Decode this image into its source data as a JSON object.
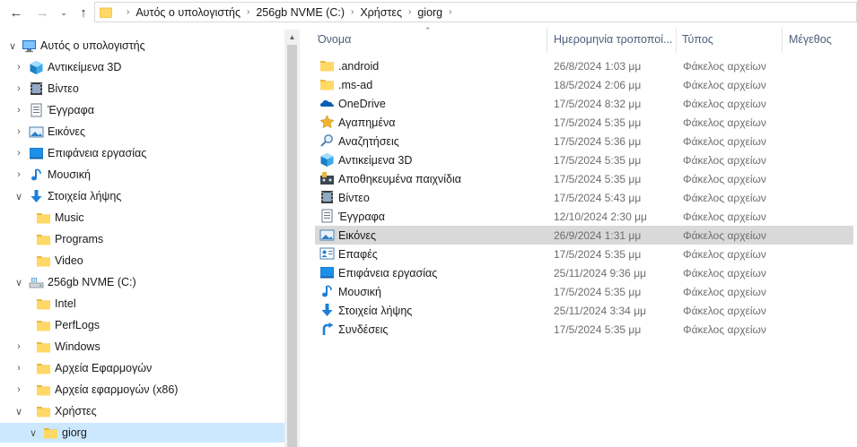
{
  "address_bar": {
    "crumbs": [
      "Αυτός ο υπολογιστής",
      "256gb NVME (C:)",
      "Χρήστες",
      "giorg"
    ]
  },
  "nav_tree": [
    {
      "label": "Αυτός ο υπολογιστής",
      "icon": "computer-icon",
      "level": 0,
      "expanded": true
    },
    {
      "label": "Αντικείμενα 3D",
      "icon": "3d-objects-icon",
      "level": 1,
      "expanded": false
    },
    {
      "label": "Βίντεο",
      "icon": "video-icon",
      "level": 1,
      "expanded": false
    },
    {
      "label": "Έγγραφα",
      "icon": "documents-icon",
      "level": 1,
      "expanded": false
    },
    {
      "label": "Εικόνες",
      "icon": "pictures-icon",
      "level": 1,
      "expanded": false
    },
    {
      "label": "Επιφάνεια εργασίας",
      "icon": "desktop-icon",
      "level": 1,
      "expanded": false
    },
    {
      "label": "Μουσική",
      "icon": "music-icon",
      "level": 1,
      "expanded": false
    },
    {
      "label": "Στοιχεία λήψης",
      "icon": "downloads-icon",
      "level": 1,
      "expanded": true
    },
    {
      "label": "Music",
      "icon": "folder-icon",
      "level": 2,
      "expanded": null
    },
    {
      "label": "Programs",
      "icon": "folder-icon",
      "level": 2,
      "expanded": null
    },
    {
      "label": "Video",
      "icon": "folder-icon",
      "level": 2,
      "expanded": null
    },
    {
      "label": "256gb NVME (C:)",
      "icon": "drive-icon",
      "level": 1,
      "expanded": true
    },
    {
      "label": "Intel",
      "icon": "folder-icon",
      "level": 2,
      "expanded": null
    },
    {
      "label": "PerfLogs",
      "icon": "folder-icon",
      "level": 2,
      "expanded": null
    },
    {
      "label": "Windows",
      "icon": "folder-icon",
      "level": 2,
      "expanded": false
    },
    {
      "label": "Αρχεία Εφαρμογών",
      "icon": "folder-icon",
      "level": 2,
      "expanded": false
    },
    {
      "label": "Αρχεία εφαρμογών (x86)",
      "icon": "folder-icon",
      "level": 2,
      "expanded": false
    },
    {
      "label": "Χρήστες",
      "icon": "folder-icon",
      "level": 2,
      "expanded": true
    },
    {
      "label": "giorg",
      "icon": "folder-icon",
      "level": 3,
      "expanded": true,
      "selected": true
    }
  ],
  "columns": {
    "name": "Όνομα",
    "date": "Ημερομηνία τροποποί...",
    "type": "Τύπος",
    "size": "Μέγεθος"
  },
  "files": [
    {
      "name": ".android",
      "date": "26/8/2024 1:03 μμ",
      "type": "Φάκελος αρχείων",
      "icon": "folder-icon"
    },
    {
      "name": ".ms-ad",
      "date": "18/5/2024 2:06 μμ",
      "type": "Φάκελος αρχείων",
      "icon": "folder-icon"
    },
    {
      "name": "OneDrive",
      "date": "17/5/2024 8:32 μμ",
      "type": "Φάκελος αρχείων",
      "icon": "onedrive-icon"
    },
    {
      "name": "Αγαπημένα",
      "date": "17/5/2024 5:35 μμ",
      "type": "Φάκελος αρχείων",
      "icon": "favorites-star-icon"
    },
    {
      "name": "Αναζητήσεις",
      "date": "17/5/2024 5:36 μμ",
      "type": "Φάκελος αρχείων",
      "icon": "searches-icon"
    },
    {
      "name": "Αντικείμενα 3D",
      "date": "17/5/2024 5:35 μμ",
      "type": "Φάκελος αρχείων",
      "icon": "3d-objects-icon"
    },
    {
      "name": "Αποθηκευμένα παιχνίδια",
      "date": "17/5/2024 5:35 μμ",
      "type": "Φάκελος αρχείων",
      "icon": "saved-games-icon"
    },
    {
      "name": "Βίντεο",
      "date": "17/5/2024 5:43 μμ",
      "type": "Φάκελος αρχείων",
      "icon": "video-icon"
    },
    {
      "name": "Έγγραφα",
      "date": "12/10/2024 2:30 μμ",
      "type": "Φάκελος αρχείων",
      "icon": "documents-icon"
    },
    {
      "name": "Εικόνες",
      "date": "26/9/2024 1:31 μμ",
      "type": "Φάκελος αρχείων",
      "icon": "pictures-icon",
      "selected": true
    },
    {
      "name": "Επαφές",
      "date": "17/5/2024 5:35 μμ",
      "type": "Φάκελος αρχείων",
      "icon": "contacts-icon"
    },
    {
      "name": "Επιφάνεια εργασίας",
      "date": "25/11/2024 9:36 μμ",
      "type": "Φάκελος αρχείων",
      "icon": "desktop-icon"
    },
    {
      "name": "Μουσική",
      "date": "17/5/2024 5:35 μμ",
      "type": "Φάκελος αρχείων",
      "icon": "music-icon"
    },
    {
      "name": "Στοιχεία λήψης",
      "date": "25/11/2024 3:34 μμ",
      "type": "Φάκελος αρχείων",
      "icon": "downloads-icon"
    },
    {
      "name": "Συνδέσεις",
      "date": "17/5/2024 5:35 μμ",
      "type": "Φάκελος αρχείων",
      "icon": "links-icon"
    }
  ],
  "colors": {
    "folder": "#ffd865",
    "folder_dark": "#e8b83a",
    "selection_tree": "#cce8ff",
    "selection_row": "#d9d9d9",
    "header_text": "#4c607a"
  }
}
